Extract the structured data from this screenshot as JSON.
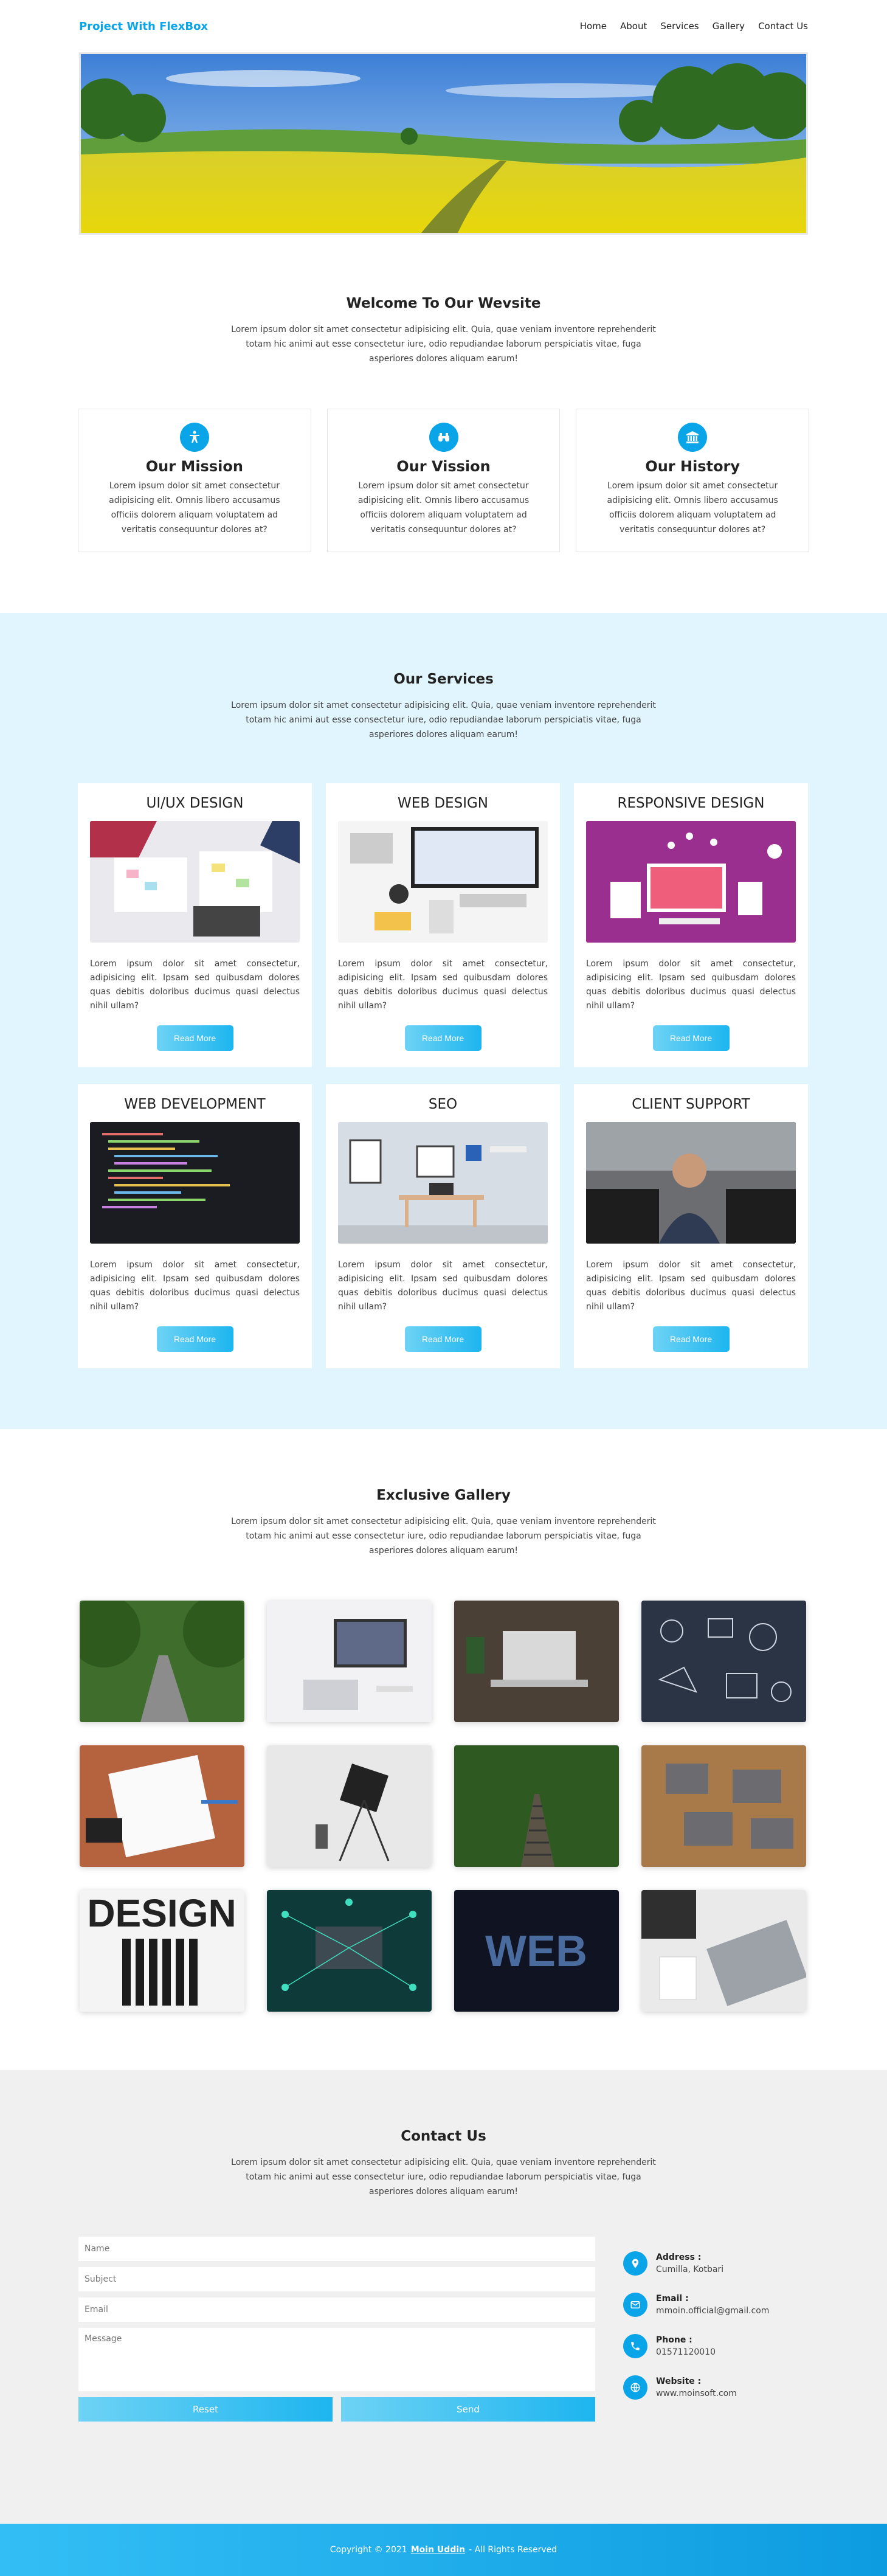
{
  "header": {
    "brand": "Project With FlexBox",
    "nav": [
      "Home",
      "About",
      "Services",
      "Gallery",
      "Contact Us"
    ]
  },
  "welcome": {
    "title": "Welcome To Our Wevsite",
    "text": "Lorem ipsum dolor sit amet consectetur adipisicing elit. Quia, quae veniam inventore reprehenderit totam hic animi aut esse consectetur iure, odio repudiandae laborum perspiciatis vitae, fuga asperiores dolores aliquam earum!",
    "cards": [
      {
        "title": "Our Mission",
        "icon": "accessibility-icon",
        "text": "Lorem ipsum dolor sit amet consectetur adipisicing elit. Omnis libero accusamus officiis dolorem aliquam voluptatem ad veritatis consequuntur dolores at?"
      },
      {
        "title": "Our Vission",
        "icon": "binoculars-icon",
        "text": "Lorem ipsum dolor sit amet consectetur adipisicing elit. Omnis libero accusamus officiis dolorem aliquam voluptatem ad veritatis consequuntur dolores at?"
      },
      {
        "title": "Our History",
        "icon": "institution-icon",
        "text": "Lorem ipsum dolor sit amet consectetur adipisicing elit. Omnis libero accusamus officiis dolorem aliquam voluptatem ad veritatis consequuntur dolores at?"
      }
    ]
  },
  "services": {
    "title": "Our Services",
    "text": "Lorem ipsum dolor sit amet consectetur adipisicing elit. Quia, quae veniam inventore reprehenderit totam hic animi aut esse consectetur iure, odio repudiandae laborum perspiciatis vitae, fuga asperiores dolores aliquam earum!",
    "button_label": "Read More",
    "items": [
      {
        "title": "UI/UX DESIGN",
        "text": "Lorem ipsum dolor sit amet consectetur, adipisicing elit. Ipsam sed quibusdam dolores quas debitis doloribus ducimus quasi delectus nihil ullam?"
      },
      {
        "title": "WEB DESIGN",
        "text": "Lorem ipsum dolor sit amet consectetur, adipisicing elit. Ipsam sed quibusdam dolores quas debitis doloribus ducimus quasi delectus nihil ullam?"
      },
      {
        "title": "RESPONSIVE DESIGN",
        "text": "Lorem ipsum dolor sit amet consectetur, adipisicing elit. Ipsam sed quibusdam dolores quas debitis doloribus ducimus quasi delectus nihil ullam?"
      },
      {
        "title": "WEB DEVELOPMENT",
        "text": "Lorem ipsum dolor sit amet consectetur, adipisicing elit. Ipsam sed quibusdam dolores quas debitis doloribus ducimus quasi delectus nihil ullam?"
      },
      {
        "title": "SEO",
        "text": "Lorem ipsum dolor sit amet consectetur, adipisicing elit. Ipsam sed quibusdam dolores quas debitis doloribus ducimus quasi delectus nihil ullam?"
      },
      {
        "title": "CLIENT SUPPORT",
        "text": "Lorem ipsum dolor sit amet consectetur, adipisicing elit. Ipsam sed quibusdam dolores quas debitis doloribus ducimus quasi delectus nihil ullam?"
      }
    ]
  },
  "gallery": {
    "title": "Exclusive Gallery",
    "text": "Lorem ipsum dolor sit amet consectetur adipisicing elit. Quia, quae veniam inventore reprehenderit totam hic animi aut esse consectetur iure, odio repudiandae laborum perspiciatis vitae, fuga asperiores dolores aliquam earum!",
    "design_word": "DESIGN",
    "web_word": "WEB"
  },
  "contact": {
    "title": "Contact Us",
    "text": "Lorem ipsum dolor sit amet consectetur adipisicing elit. Quia, quae veniam inventore reprehenderit totam hic animi aut esse consectetur iure, odio repudiandae laborum perspiciatis vitae, fuga asperiores dolores aliquam earum!",
    "placeholders": {
      "name": "Name",
      "subject": "Subject",
      "email": "Email",
      "message": "Message"
    },
    "reset_label": "Reset",
    "send_label": "Send",
    "info": [
      {
        "label": "Address :",
        "value": "Cumilla, Kotbari",
        "icon": "location-pin-icon"
      },
      {
        "label": "Email :",
        "value": "mmoin.official@gmail.com",
        "icon": "envelope-icon"
      },
      {
        "label": "Phone :",
        "value": "01571120010",
        "icon": "phone-icon"
      },
      {
        "label": "Website :",
        "value": "www.moinsoft.com",
        "icon": "globe-icon"
      }
    ]
  },
  "footer": {
    "prefix": "Copyright © 2021",
    "author": "Moin Uddin",
    "suffix": "- All Rights Reserved"
  },
  "colors": {
    "accent": "#0aa4e8",
    "services_bg": "#e1f5fe",
    "contact_bg": "#f0f0f0"
  }
}
